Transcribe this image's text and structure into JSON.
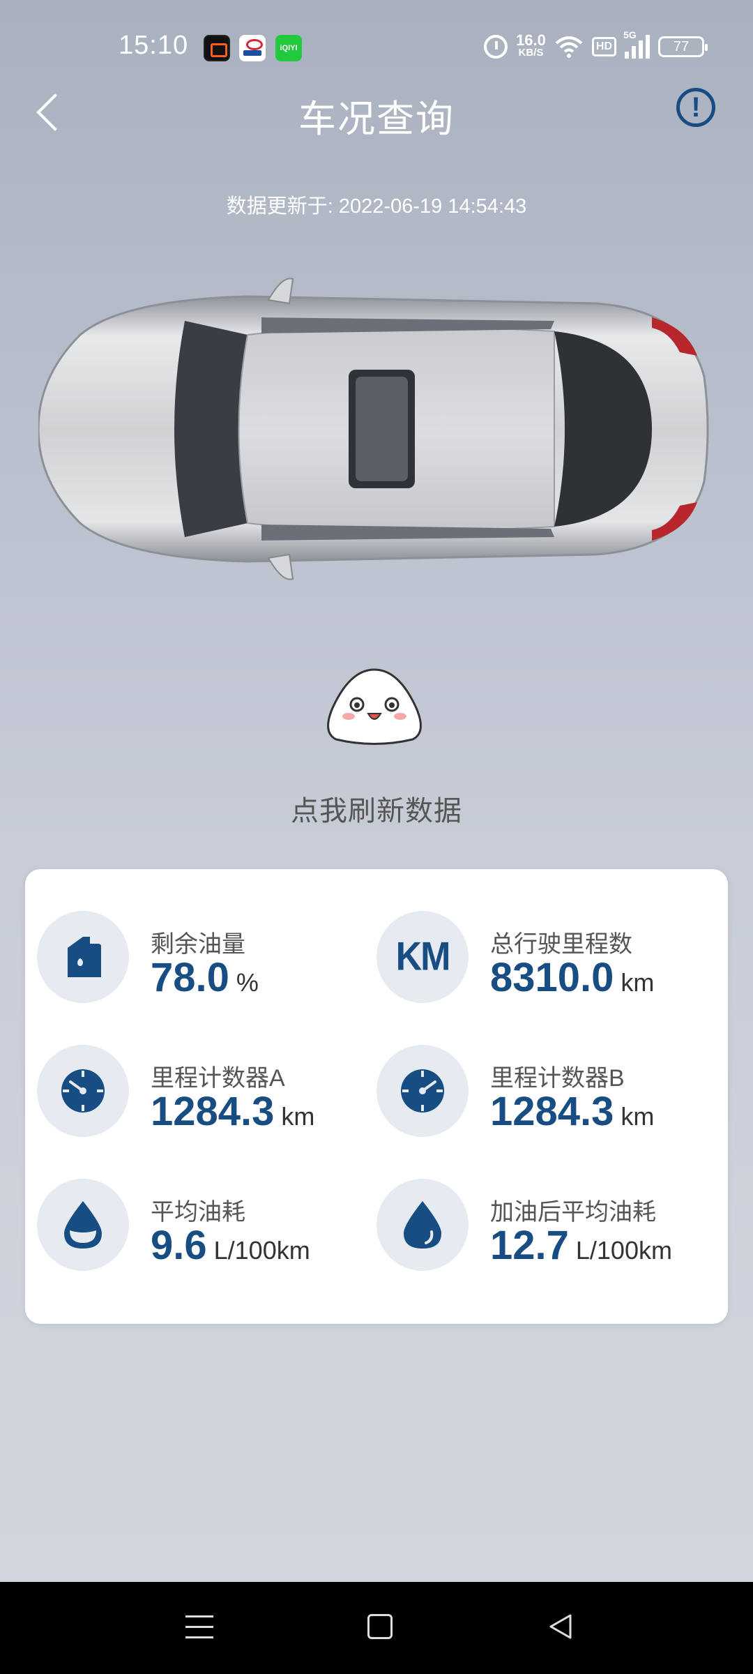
{
  "status_bar": {
    "time": "15:10",
    "app_icons": [
      "app-icon-1",
      "app-icon-2",
      "iqiyi-icon"
    ],
    "iqiyi_label": "iQIYI",
    "net_speed_value": "16.0",
    "net_speed_unit": "KB/S",
    "hd": "HD",
    "signal_tag": "5G",
    "battery": "77"
  },
  "header": {
    "title": "车况查询",
    "back_icon": "chevron-left-icon",
    "info_icon": "exclamation-circle-icon"
  },
  "update_time": "数据更新于: 2022-06-19 14:54:43",
  "refresh_label": "点我刷新数据",
  "colors": {
    "accent": "#174d82",
    "card_bg": "#ffffff",
    "icon_bg": "#e6eaf1"
  },
  "stats": [
    {
      "label": "剩余油量",
      "value": "78.0",
      "unit": "%",
      "icon": "fuel-tank-icon"
    },
    {
      "label": "总行驶里程数",
      "value": "8310.0",
      "unit": "km",
      "icon": "km-icon",
      "icon_text": "KM"
    },
    {
      "label": "里程计数器A",
      "value": "1284.3",
      "unit": "km",
      "icon": "gauge-a-icon"
    },
    {
      "label": "里程计数器B",
      "value": "1284.3",
      "unit": "km",
      "icon": "gauge-b-icon"
    },
    {
      "label": "平均油耗",
      "value": "9.6",
      "unit": "L/100km",
      "icon": "drop-half-icon"
    },
    {
      "label": "加油后平均油耗",
      "value": "12.7",
      "unit": "L/100km",
      "icon": "drop-icon"
    }
  ],
  "nav": {
    "menu": "menu-icon",
    "home": "home-icon",
    "back": "back-triangle-icon"
  }
}
